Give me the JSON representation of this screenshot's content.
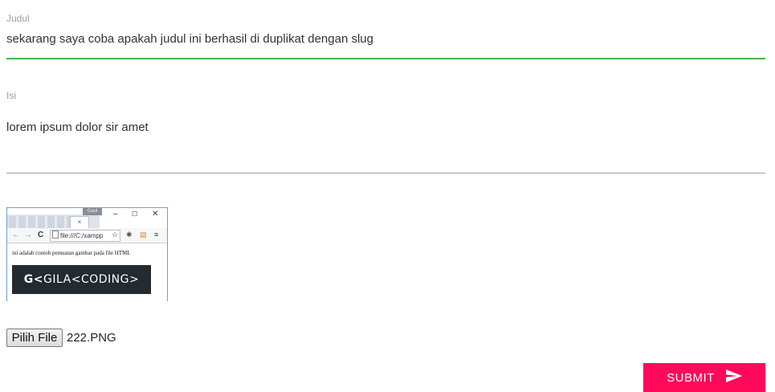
{
  "form": {
    "judul": {
      "label": "Judul",
      "value": "sekarang saya coba apakah judul ini berhasil di duplikat dengan slug"
    },
    "isi": {
      "label": "Isi",
      "value": "lorem ipsum dolor sir amet"
    },
    "preview": {
      "tab_close": "×",
      "badge": "Gaul",
      "window_buttons": [
        "–",
        "☐",
        "✕"
      ],
      "nav_icons": [
        "←",
        "→",
        "C"
      ],
      "address": "file:///C:/xampp",
      "star": "☆",
      "menu_icon": "≡",
      "body_text": "ini adalah contoh pemuatan gambar pada file HTML",
      "logo_text": "GILA<CODING>"
    },
    "file": {
      "button_label": "Pilih File",
      "file_name": "222.PNG"
    },
    "submit_label": "SUBMIT"
  },
  "colors": {
    "accent": "#ff0a5b",
    "active_underline": "#4caf50",
    "label": "#9e9e9e"
  },
  "icons": {
    "submit": "send-icon"
  }
}
